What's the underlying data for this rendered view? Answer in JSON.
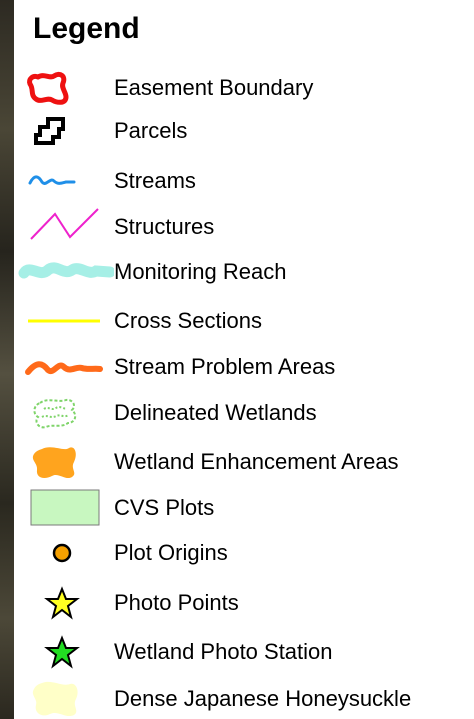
{
  "legend": {
    "title": "Legend",
    "items": [
      {
        "label": "Easement Boundary",
        "icon": "easement-boundary-icon",
        "color": "#ee1111"
      },
      {
        "label": "Parcels",
        "icon": "parcels-icon",
        "color": "#000000"
      },
      {
        "label": "Streams",
        "icon": "streams-icon",
        "color": "#1f8fe8"
      },
      {
        "label": "Structures",
        "icon": "structures-icon",
        "color": "#ee22cc"
      },
      {
        "label": "Monitoring Reach",
        "icon": "monitoring-reach-icon",
        "color": "#a6efe6"
      },
      {
        "label": "Cross Sections",
        "icon": "cross-sections-icon",
        "color": "#ffff00"
      },
      {
        "label": "Stream Problem Areas",
        "icon": "stream-problem-areas-icon",
        "color": "#ff6a1a"
      },
      {
        "label": "Delineated Wetlands",
        "icon": "delineated-wetlands-icon",
        "color": "#7fd46a"
      },
      {
        "label": "Wetland Enhancement Areas",
        "icon": "wetland-enhancement-areas-icon",
        "color": "#ffa41e"
      },
      {
        "label": "CVS Plots",
        "icon": "cvs-plots-icon",
        "color": "#c8f7c0"
      },
      {
        "label": "Plot Origins",
        "icon": "plot-origins-icon",
        "color": "#f5a000"
      },
      {
        "label": "Photo Points",
        "icon": "photo-points-icon",
        "color": "#ffff22"
      },
      {
        "label": "Wetland Photo Station",
        "icon": "wetland-photo-station-icon",
        "color": "#22dd22"
      },
      {
        "label": "Dense Japanese Honeysuckle",
        "icon": "dense-japanese-honeysuckle-icon",
        "color": "#ffffc8"
      }
    ]
  }
}
